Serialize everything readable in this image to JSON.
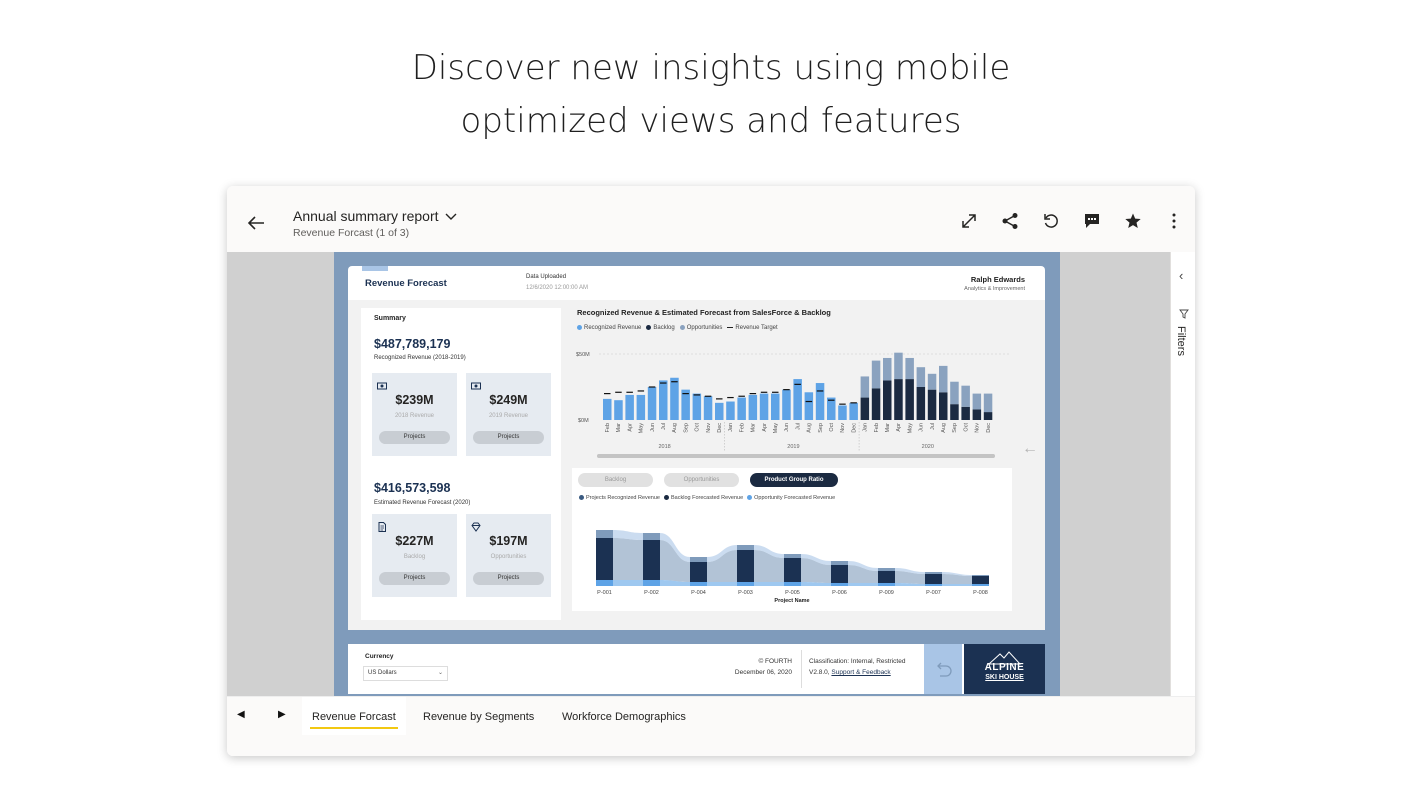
{
  "headline": {
    "line1": "Discover new insights using mobile",
    "line2": "optimized views and features"
  },
  "topbar": {
    "title": "Annual summary report",
    "subtitle": "Revenue Forcast (1 of 3)",
    "icons": [
      "back-arrow-icon",
      "chevron-down-icon",
      "expand-icon",
      "share-icon",
      "reset-icon",
      "comment-icon",
      "favorite-star-icon",
      "more-vertical-icon"
    ]
  },
  "filters": {
    "label": "Filters"
  },
  "report": {
    "header": {
      "title": "Revenue Forecast",
      "data_label": "Data Uploaded",
      "data_value": "12/6/2020 12:00:00 AM",
      "user_name": "Ralph Edwards",
      "user_role": "Analytics & Improvement"
    },
    "summary": {
      "title": "Summary",
      "recognized_value": "$487,789,179",
      "recognized_label": "Recognized Revenue (2018-2019)",
      "estimated_value": "$416,573,598",
      "estimated_label": "Estimated Revenue Forecast (2020)",
      "kpis": [
        {
          "value": "$239M",
          "label": "2018 Revenue",
          "button": "Projects"
        },
        {
          "value": "$249M",
          "label": "2019 Revenue",
          "button": "Projects"
        },
        {
          "value": "$227M",
          "label": "Backlog",
          "button": "Projects"
        },
        {
          "value": "$197M",
          "label": "Opportunities",
          "button": "Projects"
        }
      ]
    },
    "top_chart": {
      "title": "Recognized Revenue & Estimated Forecast from SalesForce & Backlog",
      "legend": [
        "Recognized Revenue",
        "Backlog",
        "Opportunities",
        "Revenue Target"
      ]
    },
    "bottom_chart": {
      "pills": [
        "Backlog",
        "Opportunities",
        "Product Group Ratio"
      ],
      "legend": [
        "Projects Recognized Revenue",
        "Backlog Forecasted Revenue",
        "Opportunity Forecasted Revenue"
      ]
    },
    "footer": {
      "currency_label": "Currency",
      "currency_value": "US Dollars",
      "copyright": "© FOURTH",
      "date": "December 06, 2020",
      "classification": "Classification: Internal, Restricted",
      "version": "V2.8.0",
      "support_link": "Support & Feedback",
      "logo_line1": "ALPINE",
      "logo_line2": "SKI HOUSE"
    }
  },
  "tabs": [
    {
      "label": "Revenue Forcast",
      "active": true
    },
    {
      "label": "Revenue by Segments",
      "active": false
    },
    {
      "label": "Workforce Demographics",
      "active": false
    }
  ],
  "colors": {
    "recognized": "#5ea3e6",
    "backlog": "#1b2a41",
    "opportunities": "#8aa2bf",
    "accent_tab": "#f2c811",
    "navy": "#1b3152"
  },
  "chart_data": [
    {
      "type": "bar",
      "title": "Recognized Revenue & Estimated Forecast from SalesForce & Backlog",
      "ylim": [
        0,
        50
      ],
      "y_ticks": [
        "$0M",
        "$50M"
      ],
      "groups": [
        "2018",
        "2019",
        "2020"
      ],
      "categories": [
        "Feb",
        "Mar",
        "Apr",
        "May",
        "Jun",
        "Jul",
        "Aug",
        "Sep",
        "Oct",
        "Nov",
        "Dec",
        "Jan",
        "Feb",
        "Mar",
        "Apr",
        "May",
        "Jun",
        "Jul",
        "Aug",
        "Sep",
        "Oct",
        "Nov",
        "Dec",
        "Jan",
        "Feb",
        "Mar",
        "Apr",
        "May",
        "Jun",
        "Jul",
        "Aug",
        "Sep",
        "Oct",
        "Nov",
        "Dec"
      ],
      "series": [
        {
          "name": "Recognized Revenue",
          "values": [
            16,
            15,
            19,
            19,
            25,
            30,
            32,
            23,
            20,
            18,
            13,
            14,
            17,
            19,
            20,
            20,
            23,
            31,
            21,
            28,
            17,
            11,
            13,
            0,
            0,
            0,
            0,
            0,
            0,
            0,
            0,
            0,
            0,
            0,
            0
          ]
        },
        {
          "name": "Backlog",
          "values": [
            0,
            0,
            0,
            0,
            0,
            0,
            0,
            0,
            0,
            0,
            0,
            0,
            0,
            0,
            0,
            0,
            0,
            0,
            0,
            0,
            0,
            0,
            0,
            17,
            24,
            30,
            31,
            31,
            25,
            23,
            21,
            12,
            10,
            8,
            6
          ]
        },
        {
          "name": "Opportunities",
          "values": [
            0,
            0,
            0,
            0,
            0,
            0,
            0,
            0,
            0,
            0,
            0,
            0,
            0,
            0,
            0,
            0,
            0,
            0,
            0,
            0,
            0,
            0,
            0,
            16,
            21,
            17,
            20,
            16,
            15,
            12,
            20,
            17,
            16,
            12,
            14
          ]
        },
        {
          "name": "Revenue Target",
          "values": [
            20,
            21,
            21,
            22,
            25,
            28,
            29,
            20,
            19,
            18,
            16,
            17,
            18,
            20,
            21,
            21,
            23,
            27,
            14,
            22,
            15,
            12,
            13,
            0,
            0,
            0,
            0,
            0,
            0,
            0,
            0,
            0,
            0,
            0,
            0
          ]
        }
      ]
    },
    {
      "type": "bar",
      "xlabel": "Project Name",
      "categories": [
        "P-001",
        "P-002",
        "P-004",
        "P-003",
        "P-005",
        "P-006",
        "P-009",
        "P-007",
        "P-008"
      ],
      "series": [
        {
          "name": "Projects Recognized Revenue",
          "values": [
            6,
            6,
            4,
            4,
            4,
            3,
            3,
            2,
            2
          ]
        },
        {
          "name": "Backlog Forecasted Revenue",
          "values": [
            42,
            40,
            20,
            32,
            24,
            18,
            12,
            10,
            8
          ]
        },
        {
          "name": "Opportunity Forecasted Revenue",
          "values": [
            8,
            7,
            5,
            5,
            4,
            4,
            3,
            2,
            1
          ]
        }
      ]
    }
  ]
}
